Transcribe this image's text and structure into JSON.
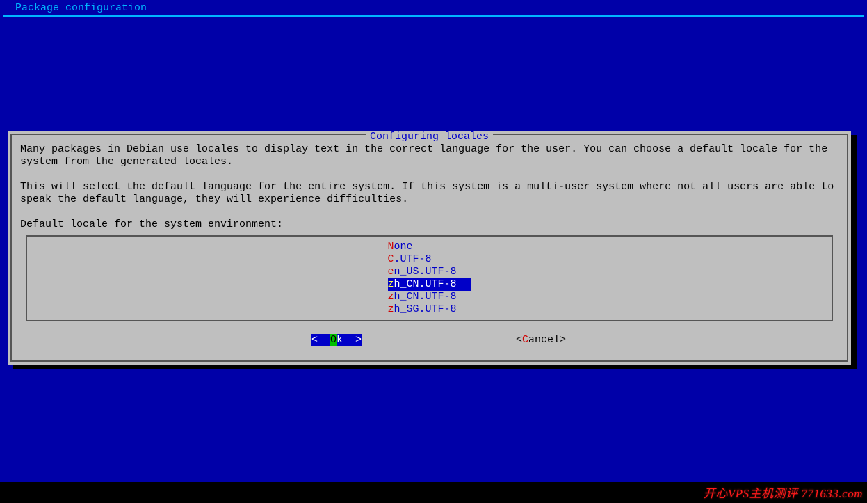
{
  "header": {
    "title": "Package configuration"
  },
  "dialog": {
    "title": "Configuring locales",
    "para1": "Many packages in Debian use locales to display text in the correct language for the user. You can choose a default locale for the system from the generated locales.",
    "para2": "This will select the default language for the entire system. If this system is a multi-user system where not all users are able to speak the default language, they will experience difficulties.",
    "prompt": "Default locale for the system environment:",
    "options": [
      {
        "hot": "N",
        "rest": "one",
        "selected": false
      },
      {
        "hot": "C",
        "rest": ".UTF-8",
        "selected": false
      },
      {
        "hot": "e",
        "rest": "n_US.UTF-8",
        "selected": false
      },
      {
        "hot": "z",
        "rest": "h_CN.UTF-8",
        "selected": true
      },
      {
        "hot": "z",
        "rest": "h_CN.UTF-8",
        "selected": false
      },
      {
        "hot": "z",
        "rest": "h_SG.UTF-8",
        "selected": false
      }
    ],
    "buttons": {
      "ok": {
        "pre": "<  ",
        "hot": "O",
        "post": "k  >"
      },
      "cancel": {
        "pre": "<",
        "hot": "C",
        "post": "ancel>"
      }
    }
  },
  "watermark": "开心VPS主机测评 771633.com"
}
